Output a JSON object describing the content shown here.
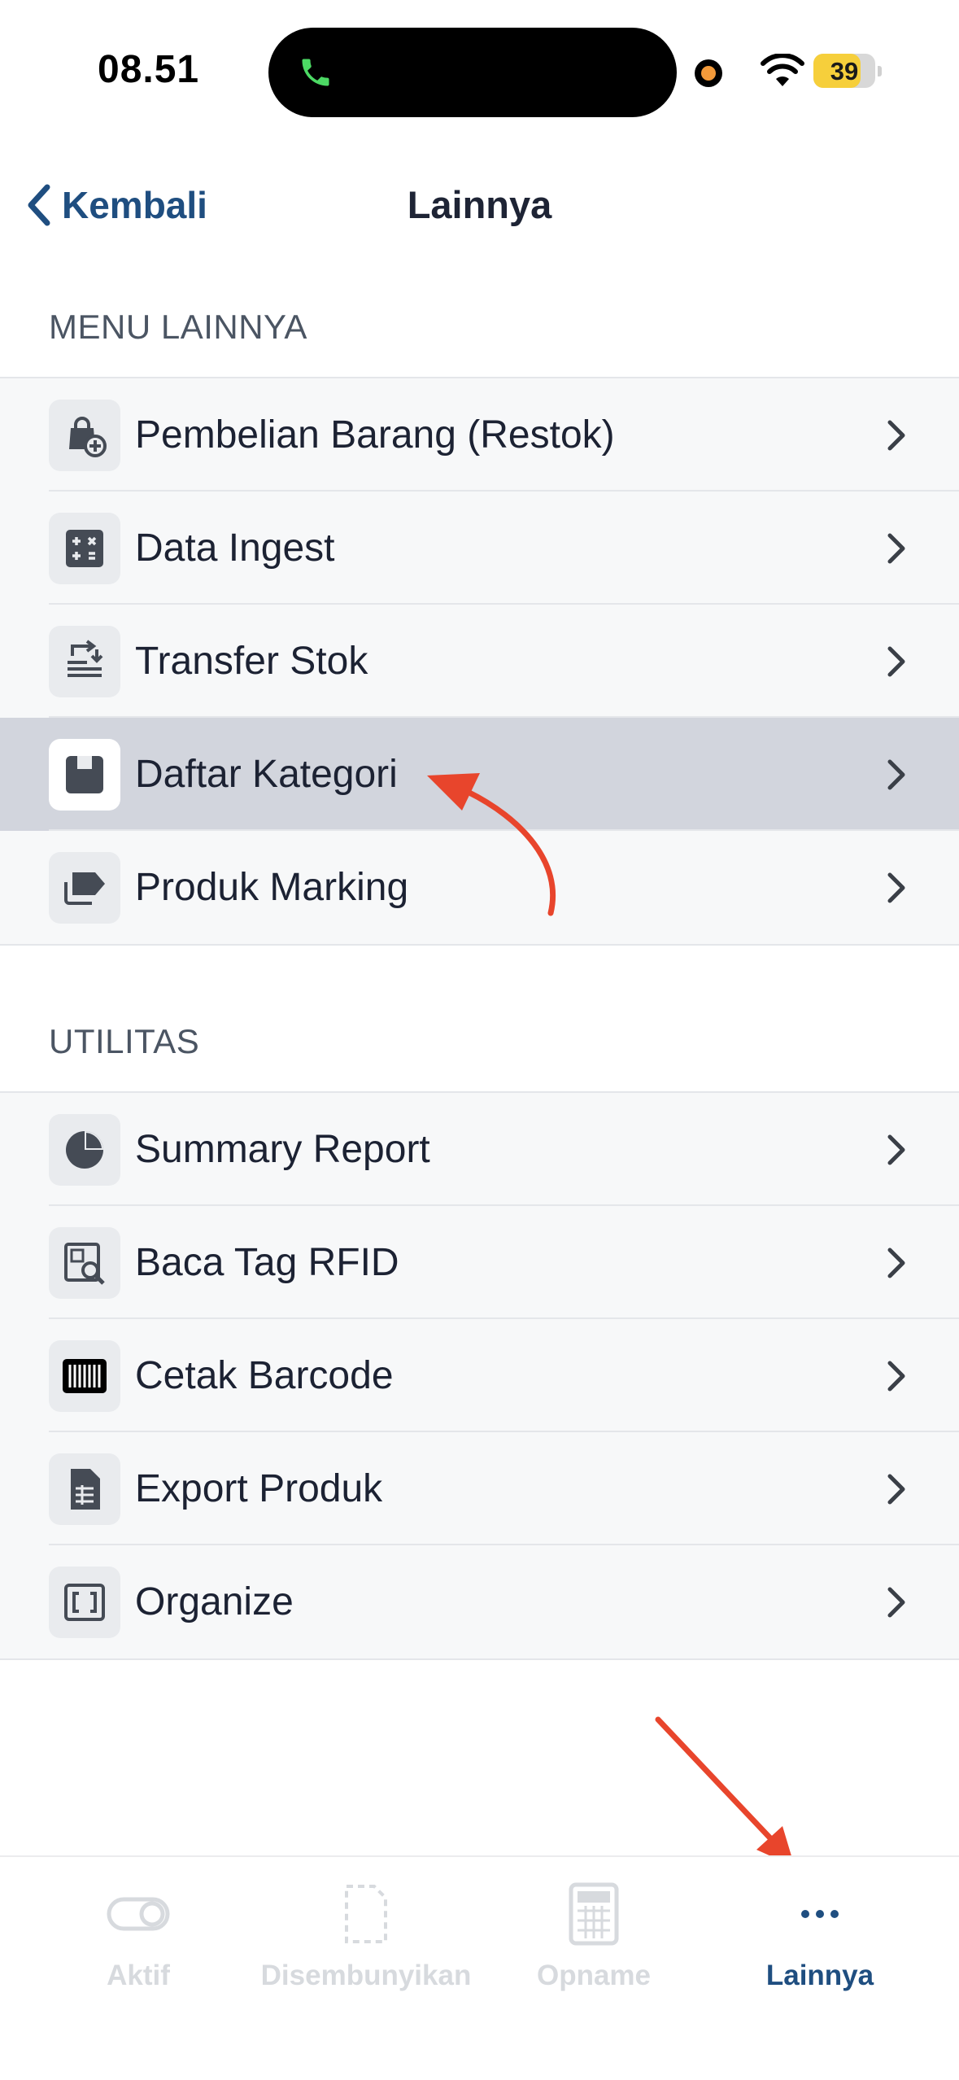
{
  "status_bar": {
    "time": "08.51",
    "battery": "39",
    "call_icon": "phone-icon",
    "accent_call": "#4cd964",
    "battery_color": "#f6cf3b"
  },
  "nav": {
    "back_label": "Kembali",
    "title": "Lainnya"
  },
  "sections": {
    "menu": {
      "header": "MENU LAINNYA",
      "items": [
        {
          "label": "Pembelian Barang (Restok)",
          "icon": "shopping-bag-plus-icon"
        },
        {
          "label": "Data Ingest",
          "icon": "calculator-icon"
        },
        {
          "label": "Transfer Stok",
          "icon": "transfer-icon"
        },
        {
          "label": "Daftar Kategori",
          "icon": "category-icon",
          "selected": true
        },
        {
          "label": "Produk Marking",
          "icon": "tag-icon"
        }
      ]
    },
    "utilitas": {
      "header": "UTILITAS",
      "items": [
        {
          "label": "Summary Report",
          "icon": "pie-chart-icon"
        },
        {
          "label": "Baca Tag RFID",
          "icon": "rfid-search-icon"
        },
        {
          "label": "Cetak Barcode",
          "icon": "barcode-icon"
        },
        {
          "label": "Export Produk",
          "icon": "spreadsheet-file-icon"
        },
        {
          "label": "Organize",
          "icon": "organize-icon"
        }
      ]
    }
  },
  "tabbar": {
    "tabs": [
      {
        "label": "Aktif",
        "icon": "toggle-icon"
      },
      {
        "label": "Disembunyikan",
        "icon": "hidden-file-icon"
      },
      {
        "label": "Opname",
        "icon": "calculator-icon"
      },
      {
        "label": "Lainnya",
        "icon": "more-dots-icon",
        "active": true
      }
    ]
  },
  "colors": {
    "accent": "#1f4e80",
    "selected_row": "#d2d5dd",
    "annotation_arrow": "#e8452c"
  }
}
